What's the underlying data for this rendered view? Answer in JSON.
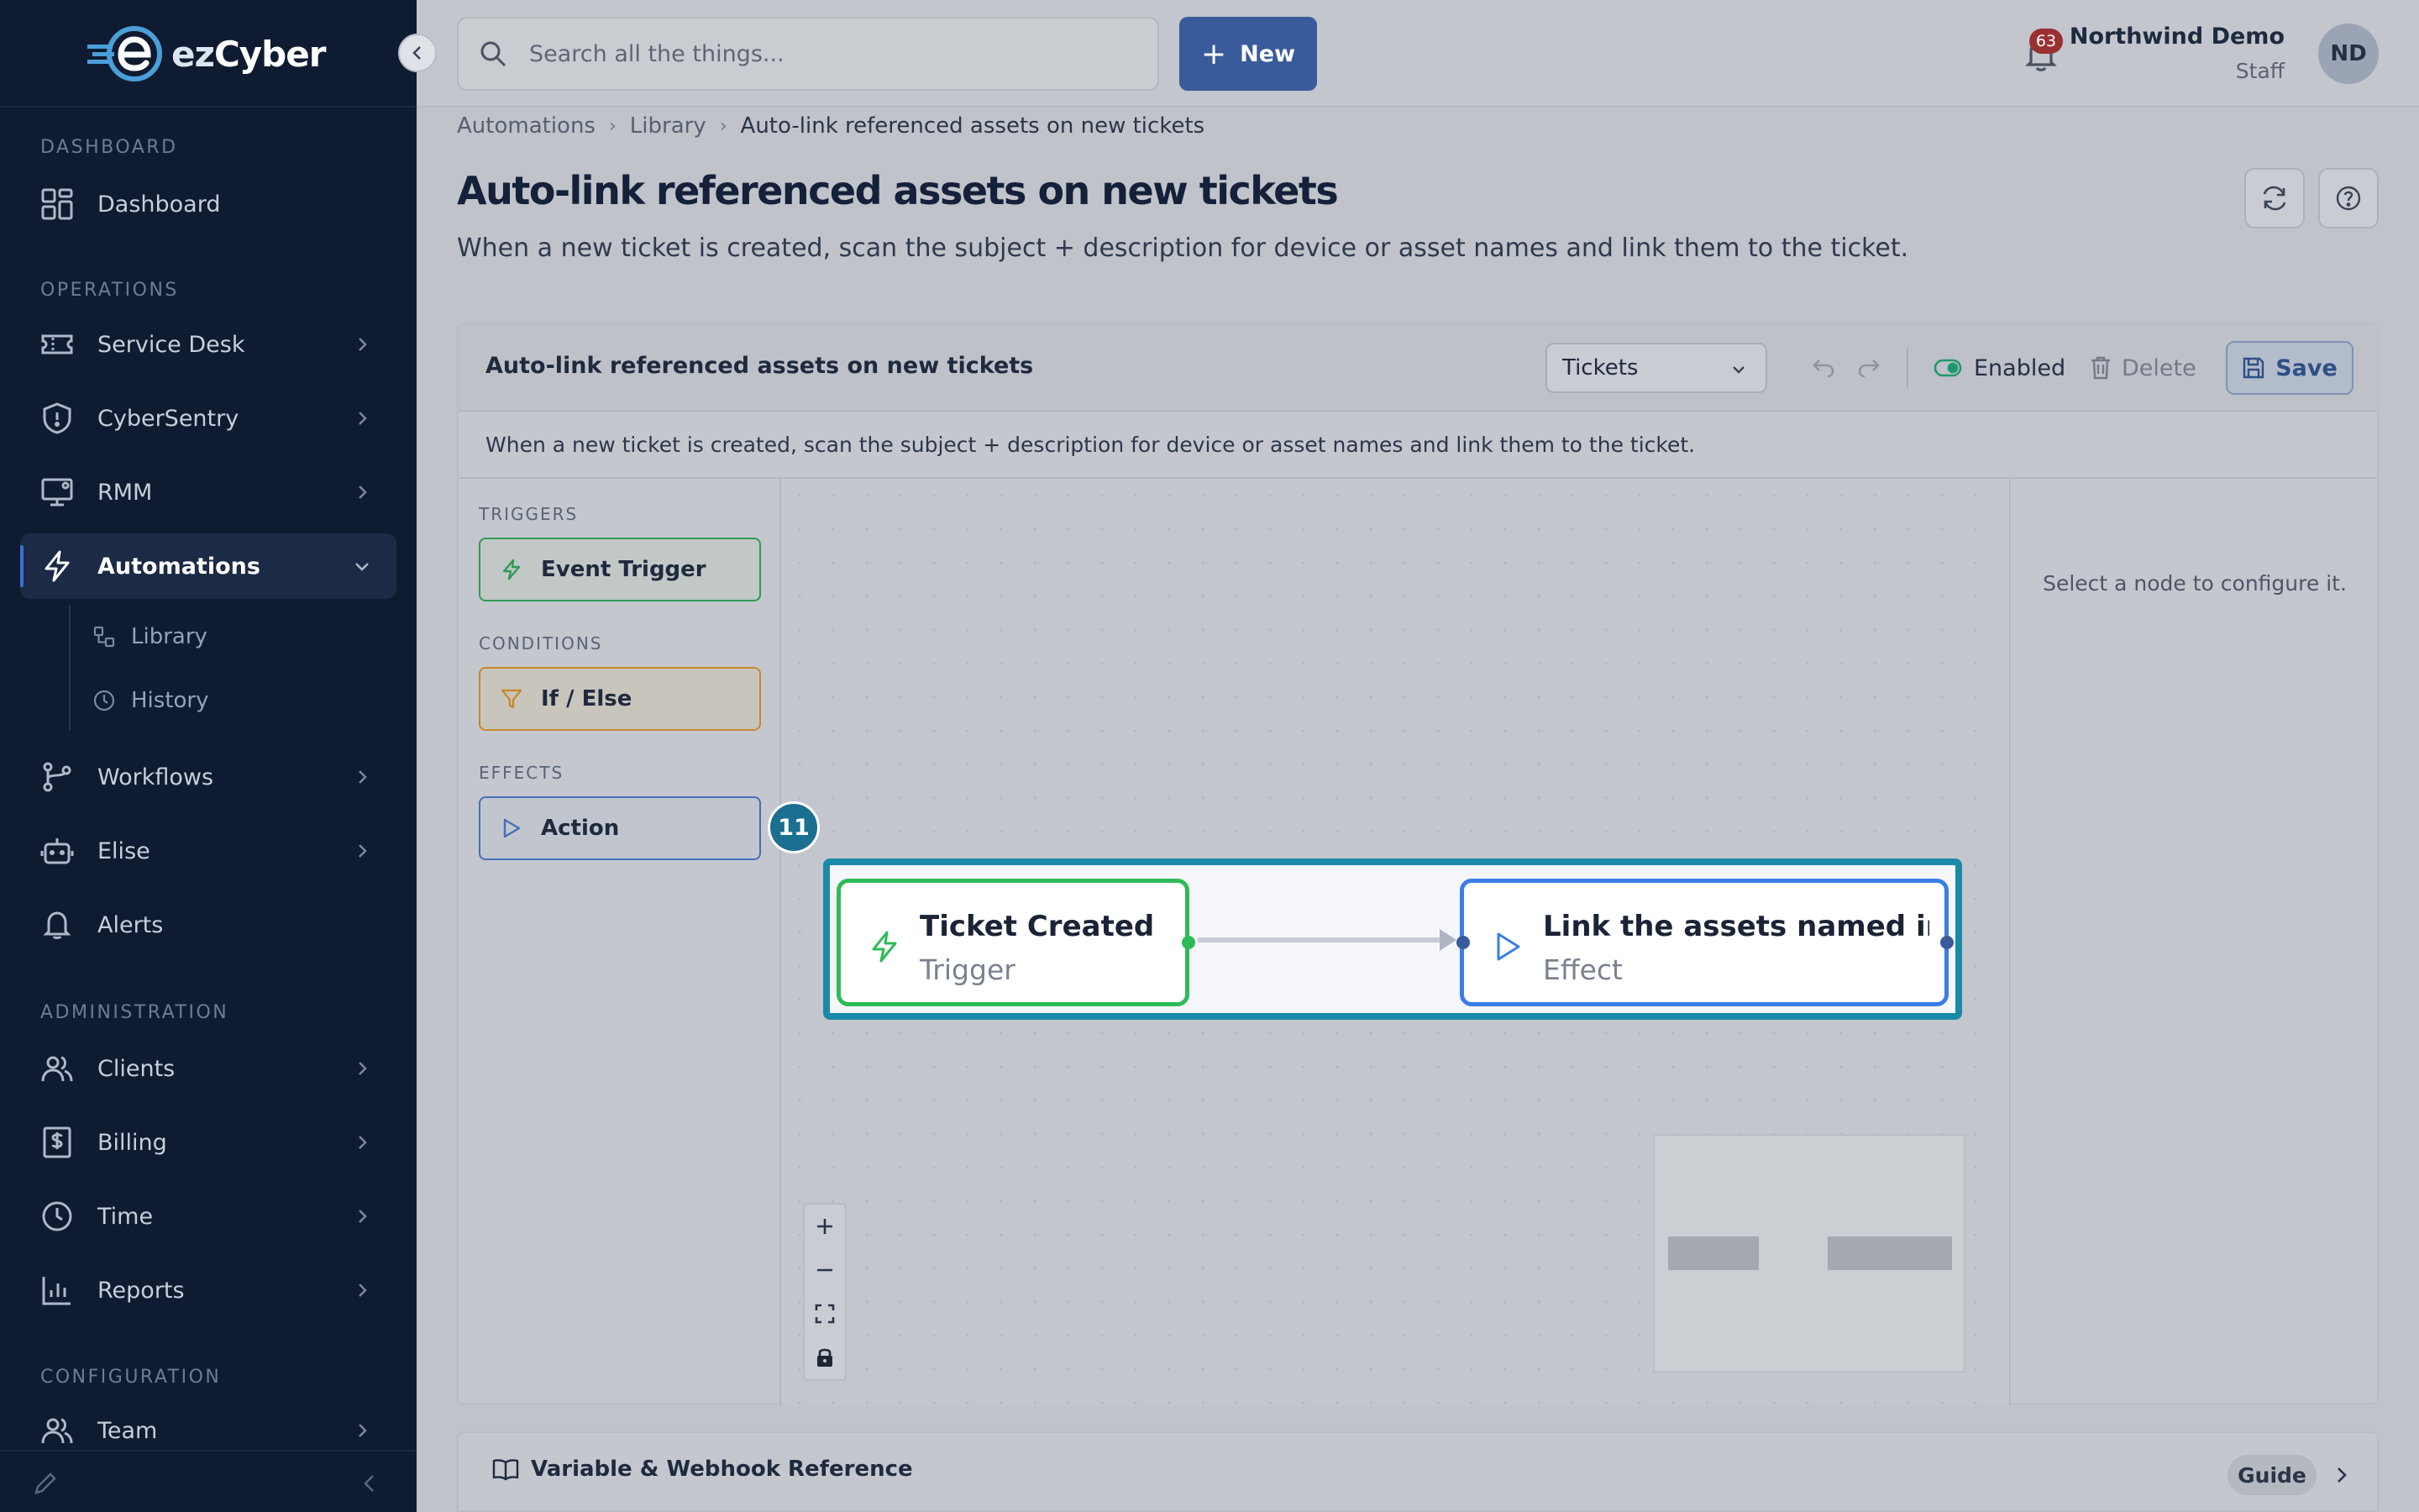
{
  "brand": {
    "logo_ez": "ez",
    "logo_cyber": "Cyber"
  },
  "sidebar": {
    "sections": {
      "dashboard": "DASHBOARD",
      "operations": "OPERATIONS",
      "administration": "ADMINISTRATION",
      "configuration": "CONFIGURATION"
    },
    "items": {
      "dashboard": "Dashboard",
      "service_desk": "Service Desk",
      "cybersentry": "CyberSentry",
      "rmm": "RMM",
      "automations": "Automations",
      "library": "Library",
      "history": "History",
      "workflows": "Workflows",
      "elise": "Elise",
      "alerts": "Alerts",
      "clients": "Clients",
      "billing": "Billing",
      "time": "Time",
      "reports": "Reports",
      "team": "Team"
    },
    "active_item": "automations"
  },
  "topbar": {
    "search_placeholder": "Search all the things...",
    "new_label": "New",
    "notification_count": "63",
    "user_name": "Northwind Demo",
    "user_role": "Staff",
    "avatar_initials": "ND"
  },
  "breadcrumb": {
    "items": [
      "Automations",
      "Library",
      "Auto-link referenced assets on new tickets"
    ]
  },
  "page": {
    "title": "Auto-link referenced assets on new tickets",
    "description": "When a new ticket is created, scan the subject + description for device or asset names and link them to the ticket."
  },
  "editor": {
    "title": "Auto-link referenced assets on new tickets",
    "module_select": "Tickets",
    "enabled_label": "Enabled",
    "delete_label": "Delete",
    "save_label": "Save",
    "description": "When a new ticket is created, scan the subject + description for device or asset names and link them to the ticket."
  },
  "palette": {
    "triggers_label": "TRIGGERS",
    "trigger_item": "Event Trigger",
    "conditions_label": "CONDITIONS",
    "condition_item": "If / Else",
    "effects_label": "EFFECTS",
    "effect_item": "Action"
  },
  "canvas": {
    "selection_badge": "11",
    "nodes": [
      {
        "title": "Ticket Created",
        "kind": "Trigger"
      },
      {
        "title": "Link the assets named in th...",
        "kind": "Effect"
      }
    ]
  },
  "config_panel": {
    "hint": "Select a node to configure it."
  },
  "reference_bar": {
    "title": "Variable & Webhook Reference",
    "guide_label": "Guide"
  },
  "colors": {
    "sidebar_bg": "#0f1b30",
    "accent": "#3a5b9b",
    "trigger_green": "#2dbb58",
    "effect_blue": "#3a7ee6",
    "condition_amber": "#c8892c",
    "selection_teal": "#1b8aa8",
    "badge_red": "#9b3033"
  }
}
